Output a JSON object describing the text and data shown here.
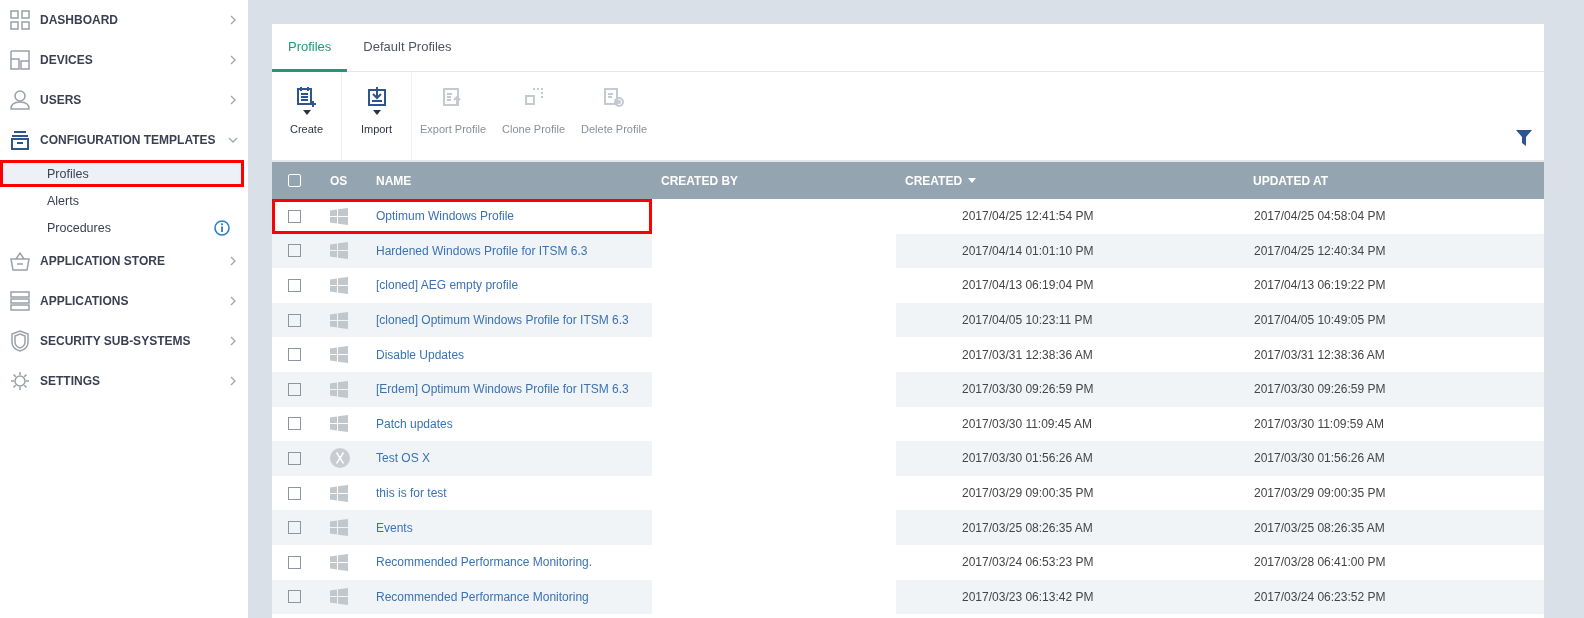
{
  "sidebar": {
    "items": [
      {
        "label": "DASHBOARD",
        "expanded": false
      },
      {
        "label": "DEVICES",
        "expanded": false
      },
      {
        "label": "USERS",
        "expanded": false
      },
      {
        "label": "CONFIGURATION TEMPLATES",
        "expanded": true,
        "children": [
          {
            "label": "Profiles",
            "selected": true,
            "highlighted": true,
            "info": false
          },
          {
            "label": "Alerts",
            "selected": false,
            "highlighted": false,
            "info": false
          },
          {
            "label": "Procedures",
            "selected": false,
            "highlighted": false,
            "info": true
          }
        ]
      },
      {
        "label": "APPLICATION STORE",
        "expanded": false
      },
      {
        "label": "APPLICATIONS",
        "expanded": false
      },
      {
        "label": "SECURITY SUB-SYSTEMS",
        "expanded": false
      },
      {
        "label": "SETTINGS",
        "expanded": false
      }
    ]
  },
  "tabs": [
    {
      "label": "Profiles",
      "selected": true
    },
    {
      "label": "Default Profiles",
      "selected": false
    }
  ],
  "toolbar": [
    {
      "label": "Create",
      "disabled": false,
      "dropdown": true
    },
    {
      "label": "Import",
      "disabled": false,
      "dropdown": true
    },
    {
      "label": "Export Profile",
      "disabled": true,
      "dropdown": false
    },
    {
      "label": "Clone Profile",
      "disabled": true,
      "dropdown": false
    },
    {
      "label": "Delete Profile",
      "disabled": true,
      "dropdown": false
    }
  ],
  "table": {
    "select_all_checked": false,
    "columns": [
      {
        "label": "OS",
        "sorted": false
      },
      {
        "label": "NAME",
        "sorted": false
      },
      {
        "label": "CREATED BY",
        "sorted": false
      },
      {
        "label": "CREATED",
        "sorted": true
      },
      {
        "label": "UPDATED AT",
        "sorted": false
      }
    ],
    "rows": [
      {
        "checked": false,
        "kind": "windows",
        "name": "Optimum Windows Profile",
        "highlighted": true,
        "created": "2017/04/25 12:41:54 PM",
        "updated": "2017/04/25 04:58:04 PM"
      },
      {
        "checked": false,
        "kind": "windows",
        "name": "Hardened Windows Profile for ITSM 6.3",
        "highlighted": false,
        "created": "2017/04/14 01:01:10 PM",
        "updated": "2017/04/25 12:40:34 PM"
      },
      {
        "checked": false,
        "kind": "windows",
        "name": "[cloned] AEG empty profile",
        "highlighted": false,
        "created": "2017/04/13 06:19:04 PM",
        "updated": "2017/04/13 06:19:22 PM"
      },
      {
        "checked": false,
        "kind": "windows",
        "name": "[cloned] Optimum Windows Profile for ITSM 6.3",
        "highlighted": false,
        "created": "2017/04/05 10:23:11 PM",
        "updated": "2017/04/05 10:49:05 PM"
      },
      {
        "checked": false,
        "kind": "windows",
        "name": "Disable Updates",
        "highlighted": false,
        "created": "2017/03/31 12:38:36 AM",
        "updated": "2017/03/31 12:38:36 AM"
      },
      {
        "checked": false,
        "kind": "windows",
        "name": "[Erdem] Optimum Windows Profile for ITSM 6.3",
        "highlighted": false,
        "created": "2017/03/30 09:26:59 PM",
        "updated": "2017/03/30 09:26:59 PM"
      },
      {
        "checked": false,
        "kind": "windows",
        "name": "Patch updates",
        "highlighted": false,
        "created": "2017/03/30 11:09:45 AM",
        "updated": "2017/03/30 11:09:59 AM"
      },
      {
        "checked": false,
        "kind": "mac",
        "name": "Test OS X",
        "highlighted": false,
        "created": "2017/03/30 01:56:26 AM",
        "updated": "2017/03/30 01:56:26 AM"
      },
      {
        "checked": false,
        "kind": "windows",
        "name": "this is for test",
        "highlighted": false,
        "created": "2017/03/29 09:00:35 PM",
        "updated": "2017/03/29 09:00:35 PM"
      },
      {
        "checked": false,
        "kind": "windows",
        "name": "Events",
        "highlighted": false,
        "created": "2017/03/25 08:26:35 AM",
        "updated": "2017/03/25 08:26:35 AM"
      },
      {
        "checked": false,
        "kind": "windows",
        "name": "Recommended Performance Monitoring.",
        "highlighted": false,
        "created": "2017/03/24 06:53:23 PM",
        "updated": "2017/03/28 06:41:00 PM"
      },
      {
        "checked": false,
        "kind": "windows",
        "name": "Recommended Performance Monitoring",
        "highlighted": false,
        "created": "2017/03/23 06:13:42 PM",
        "updated": "2017/03/24 06:23:52 PM"
      }
    ]
  }
}
